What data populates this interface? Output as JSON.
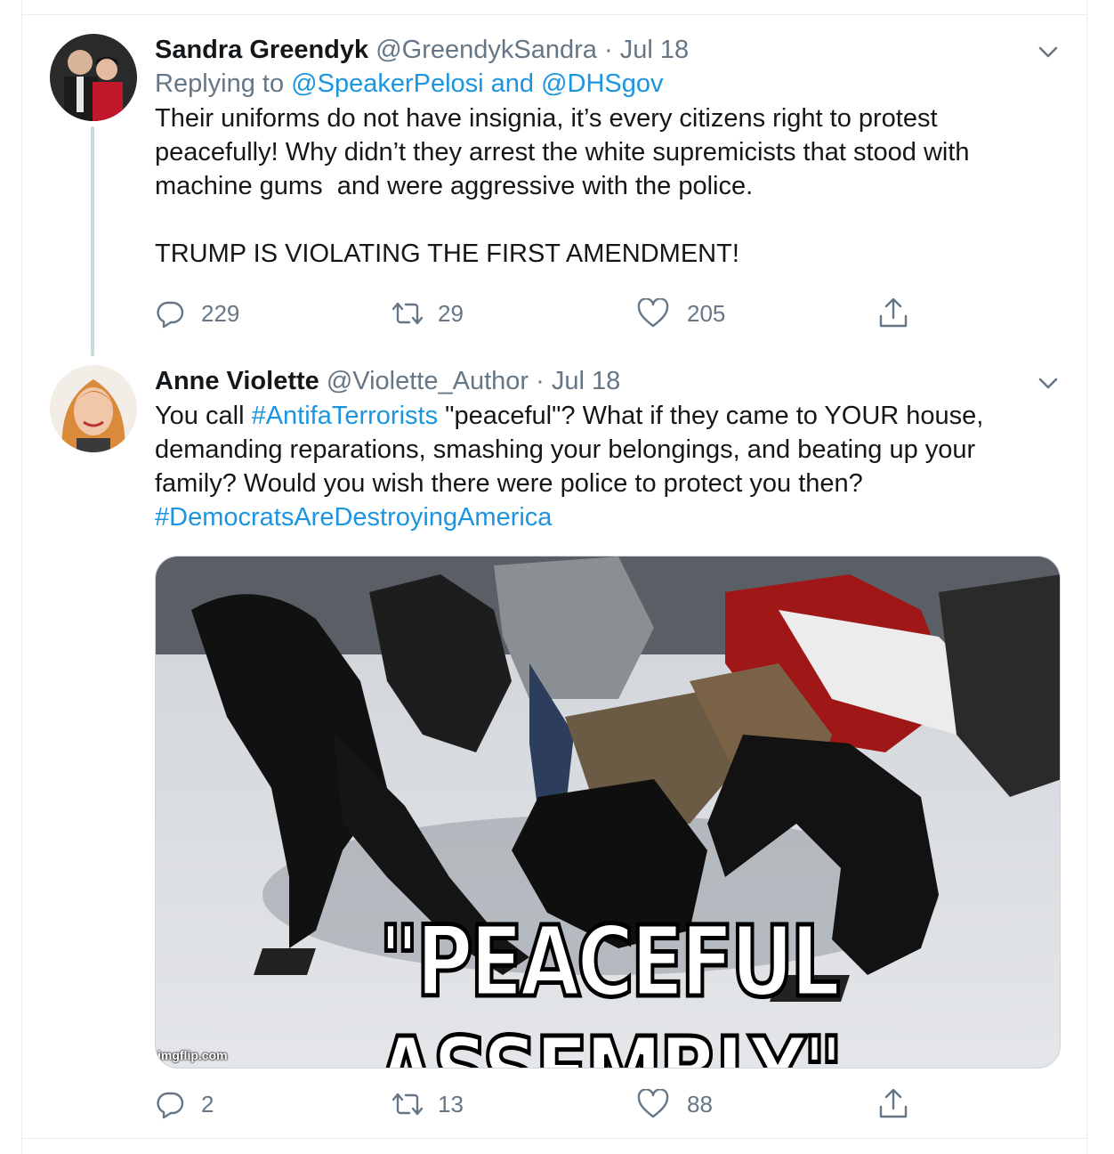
{
  "tweets": [
    {
      "display_name": "Sandra Greendyk",
      "handle": "@GreendykSandra",
      "separator": "·",
      "date": "Jul 18",
      "replying_prefix": "Replying to ",
      "replying_to_1": "@SpeakerPelosi",
      "replying_and": " and ",
      "replying_to_2": "@DHSgov",
      "body": "Their uniforms do not have insignia, it’s every citizens right to protest peacefully! Why didn’t they arrest the white supremicists that stood with machine gums  and were aggressive with the police.",
      "body_2": "TRUMP IS VIOLATING THE FIRST AMENDMENT!",
      "replies": "229",
      "retweets": "29",
      "likes": "205"
    },
    {
      "display_name": "Anne Violette",
      "handle": "@Violette_Author",
      "separator": "·",
      "date": "Jul 18",
      "body_prefix": "You call ",
      "hashtag_1": "#AntifaTerrorists",
      "body_rest": " \"peaceful\"? What if they came to YOUR house, demanding reparations, smashing your belongings, and beating up your family? Would you wish there were police to protect you then?",
      "hashtag_2": "#DemocratsAreDestroyingAmerica",
      "media_caption": "\"PEACEFUL ASSEMBLY\"",
      "media_watermark": "imgflip.com",
      "replies": "2",
      "retweets": "13",
      "likes": "88"
    }
  ],
  "colors": {
    "link": "#1b95e0",
    "secondary_text": "#657786",
    "thread_line": "#ccd6dd"
  },
  "icons": [
    "reply-icon",
    "retweet-icon",
    "like-icon",
    "share-icon",
    "chevron-down-icon"
  ]
}
